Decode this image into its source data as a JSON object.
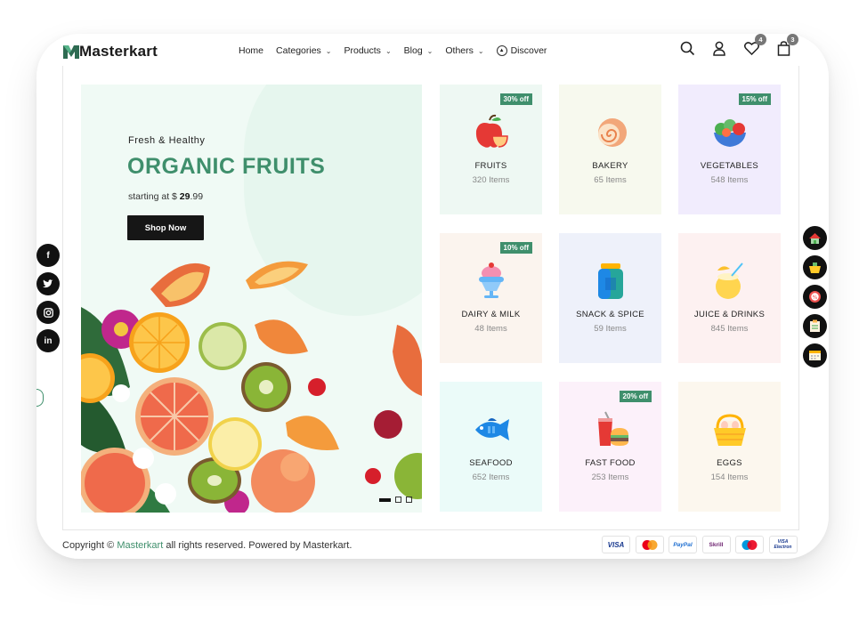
{
  "brand": {
    "name": "Masterkart",
    "accent": "#3f8f6c"
  },
  "nav": {
    "items": [
      {
        "label": "Home",
        "has_dropdown": false
      },
      {
        "label": "Categories",
        "has_dropdown": true
      },
      {
        "label": "Products",
        "has_dropdown": true
      },
      {
        "label": "Blog",
        "has_dropdown": true
      },
      {
        "label": "Others",
        "has_dropdown": true
      }
    ],
    "discover_label": "Discover"
  },
  "header_icons": {
    "wishlist_count": "4",
    "cart_count": "3"
  },
  "hero": {
    "subtitle": "Fresh & Healthy",
    "title": "ORGANIC FRUITS",
    "price_prefix": "starting at $",
    "price_value": "29",
    "price_cents": ".99",
    "button_label": "Shop Now"
  },
  "categories": [
    {
      "name": "FRUITS",
      "count": "320 Items",
      "offer": "30% off",
      "bg": "#eef8f3",
      "icon": "apple-icon"
    },
    {
      "name": "BAKERY",
      "count": "65 Items",
      "offer": "",
      "bg": "#f7f9ee",
      "icon": "roll-cake-icon"
    },
    {
      "name": "VEGETABLES",
      "count": "548 Items",
      "offer": "15% off",
      "bg": "#f1ecfd",
      "icon": "vegetables-icon"
    },
    {
      "name": "DAIRY & MILK",
      "count": "48 Items",
      "offer": "10% off",
      "bg": "#fbf4ee",
      "icon": "ice-cream-icon"
    },
    {
      "name": "SNACK & SPICE",
      "count": "59 Items",
      "offer": "",
      "bg": "#eef1fa",
      "icon": "jar-icon"
    },
    {
      "name": "JUICE & DRINKS",
      "count": "845 Items",
      "offer": "",
      "bg": "#fdf1f1",
      "icon": "coconut-drink-icon"
    },
    {
      "name": "SEAFOOD",
      "count": "652 Items",
      "offer": "",
      "bg": "#ebfbf9",
      "icon": "fish-icon"
    },
    {
      "name": "FAST FOOD",
      "count": "253 Items",
      "offer": "20% off",
      "bg": "#fcf1fa",
      "icon": "burger-soda-icon"
    },
    {
      "name": "EGGS",
      "count": "154 Items",
      "offer": "",
      "bg": "#fcf7ee",
      "icon": "egg-basket-icon"
    }
  ],
  "social": [
    "f",
    "twitter",
    "instagram",
    "in"
  ],
  "footer": {
    "copy_prefix": "Copyright ©",
    "copy_brand": "Masterkart",
    "copy_suffix": "all rights reserved. Powered by Masterkart."
  },
  "payments": [
    "VISA",
    "Mastercard",
    "PayPal",
    "Skrill",
    "Maestro",
    "VISA Electron"
  ]
}
